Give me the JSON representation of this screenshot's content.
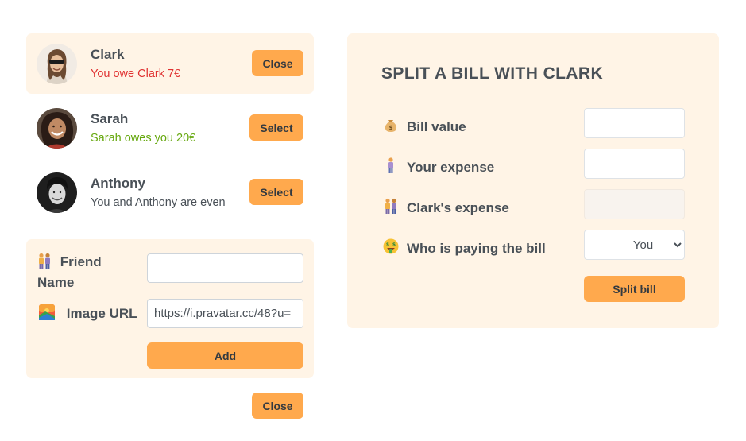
{
  "friends": [
    {
      "name": "Clark",
      "balance": "You owe Clark 7€",
      "button": "Close",
      "selected": true
    },
    {
      "name": "Sarah",
      "balance": "Sarah owes you 20€",
      "button": "Select",
      "selected": false
    },
    {
      "name": "Anthony",
      "balance": "You and Anthony are even",
      "button": "Select",
      "selected": false
    }
  ],
  "add_friend": {
    "name_label": "Friend Name",
    "name_value": "",
    "image_label": "Image URL",
    "image_value": "https://i.pravatar.cc/48?u=",
    "add_label": "Add"
  },
  "close_form_label": "Close",
  "split": {
    "title": "Split a bill with Clark",
    "bill_label": "Bill value",
    "your_label": "Your expense",
    "friend_label": "Clark's expense",
    "payer_label": "Who is paying the bill",
    "payer_selected": "You",
    "submit_label": "Split bill"
  },
  "icons": {
    "friend_name": "people-icon",
    "image_url": "image-icon",
    "bill": "money-bag-icon",
    "your_expense": "person-icon",
    "friend_expense": "people-icon",
    "payer": "money-face-icon"
  },
  "colors": {
    "accent": "#ffa94d",
    "panel": "#fff4e6",
    "red": "#e03131",
    "green": "#66a80f",
    "text": "#495057"
  }
}
